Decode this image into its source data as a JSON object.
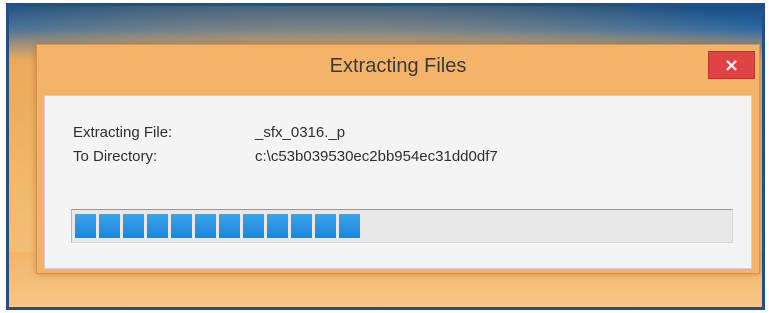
{
  "window": {
    "title": "Extracting Files",
    "close_glyph": "×",
    "close_icon": "close-icon"
  },
  "details": {
    "file_label": "Extracting File:",
    "file_value": "_sfx_0316._p",
    "dir_label": "To Directory:",
    "dir_value": "c:\\c53b039530ec2bb954ec31dd0df7"
  },
  "progress": {
    "filled_segments": 12,
    "fraction": 0.43,
    "color": "#2a94e2"
  },
  "colors": {
    "window_frame": "#f3b46a",
    "close_button": "#e04343",
    "client_bg": "#f4f4f4"
  }
}
